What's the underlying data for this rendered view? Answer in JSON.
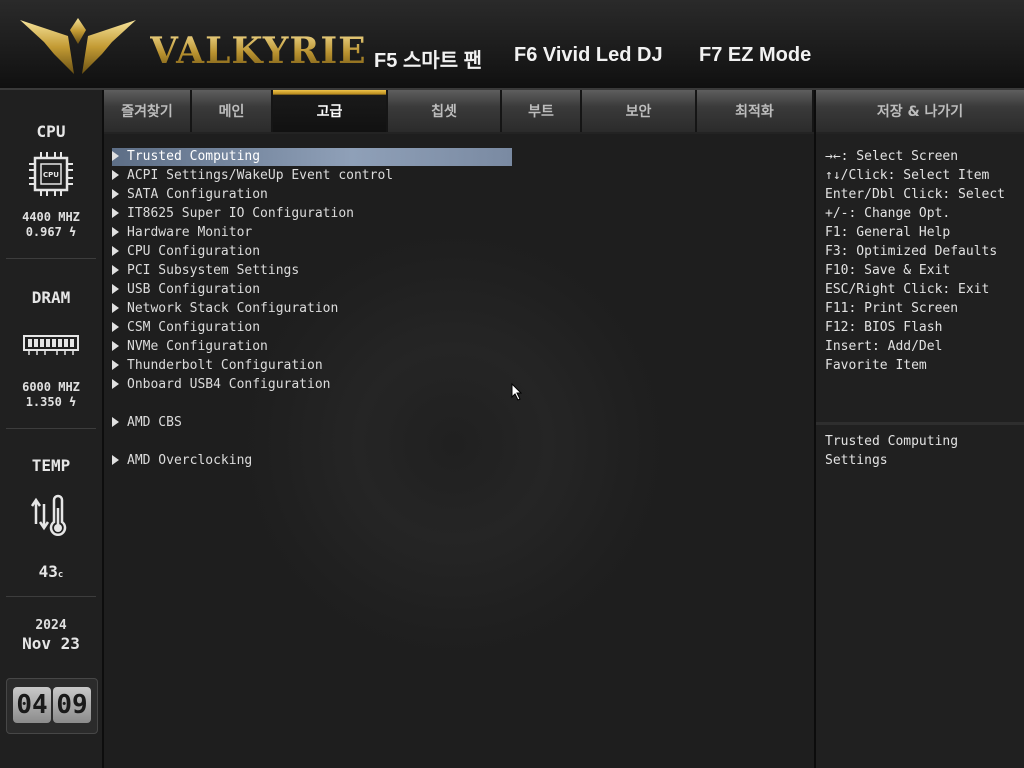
{
  "header": {
    "brand": "VALKYRIE",
    "hotkeys": [
      "F5 스마트 팬",
      "F6 Vivid Led DJ",
      "F7 EZ Mode"
    ]
  },
  "left_panel": {
    "cpu_label": "CPU",
    "cpu_chip_text": "CPU",
    "cpu_freq": "4400 MHZ",
    "cpu_voltage": "0.967",
    "dram_label": "DRAM",
    "dram_freq": "6000 MHZ",
    "dram_voltage": "1.350",
    "temp_label": "TEMP",
    "temp_value": "43",
    "temp_unit": "c",
    "year": "2024",
    "date": "Nov 23",
    "clock_hour": "04",
    "clock_min": "09"
  },
  "tabs": [
    "즐겨찾기",
    "메인",
    "고급",
    "칩셋",
    "부트",
    "보안",
    "최적화",
    "저장 & 나가기"
  ],
  "active_tab": "고급",
  "menu": [
    "Trusted Computing",
    "ACPI Settings/WakeUp Event control",
    "SATA Configuration",
    "IT8625 Super IO Configuration",
    "Hardware Monitor",
    "CPU Configuration",
    "PCI Subsystem Settings",
    "USB Configuration",
    "Network Stack Configuration",
    "CSM Configuration",
    "NVMe Configuration",
    "Thunderbolt Configuration",
    "Onboard USB4 Configuration",
    "AMD CBS",
    "AMD Overclocking"
  ],
  "selected_item": "Trusted Computing",
  "help": [
    "→←: Select Screen",
    "↑↓/Click: Select Item",
    "Enter/Dbl Click: Select",
    "+/-: Change Opt.",
    "F1: General Help",
    "F3: Optimized Defaults",
    "F10: Save & Exit",
    "ESC/Right Click: Exit",
    "F11: Print Screen",
    "F12: BIOS Flash",
    "Insert: Add/Del",
    "Favorite Item"
  ],
  "description": [
    "Trusted Computing",
    "Settings"
  ],
  "colors": {
    "accent_gold": "#c9a23a",
    "selection": "#8fa0b8"
  }
}
